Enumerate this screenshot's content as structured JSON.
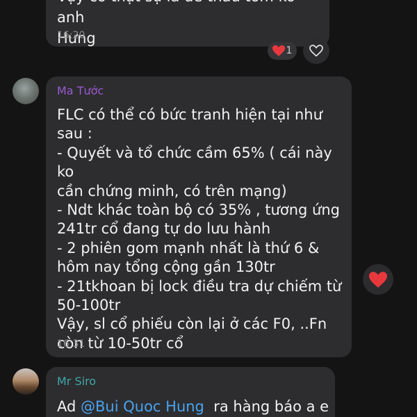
{
  "messages": [
    {
      "text": "Vậy có thật sự là đề thầu tôm ko anh\nHưng",
      "time": "16:20",
      "reaction": {
        "icon": "heart",
        "count": "1",
        "color": "#e8383d"
      }
    },
    {
      "sender": "Ma Tước",
      "sender_color": "#9b59d0",
      "text": "FLC có thể có bức tranh hiện tại như\nsau :\n- Quyết và tổ chức cầm 65% ( cái này ko\ncần chứng minh, có trên mạng)\n- Ndt khác toàn bộ có 35% , tương ứng\n241tr cổ đang tự do lưu hành\n- 2 phiên gom mạnh nhất là thứ 6 &\nhôm nay tổng cộng gần 130tr\n- 21tkhoan bị lock điều tra dự chiếm từ\n50-100tr\nVậy, sl cổ phiếu còn lại ở các F0, ..Fn\ncòn từ 10-50tr cổ",
      "time": "16:31",
      "reaction": {
        "icon": "heart",
        "color": "#e8383d"
      }
    },
    {
      "sender": "Mr Siro",
      "sender_color": "#3fa7a8",
      "text_prefix": "Ad ",
      "mention": "@Bui Quoc Hung",
      "text_suffix": "  ra hàng báo a e"
    }
  ],
  "colors": {
    "background": "#141414",
    "bubble": "#2d2d2f",
    "text": "#f2f2f2",
    "time": "#8a8a8a",
    "mention": "#4aa3f0"
  }
}
